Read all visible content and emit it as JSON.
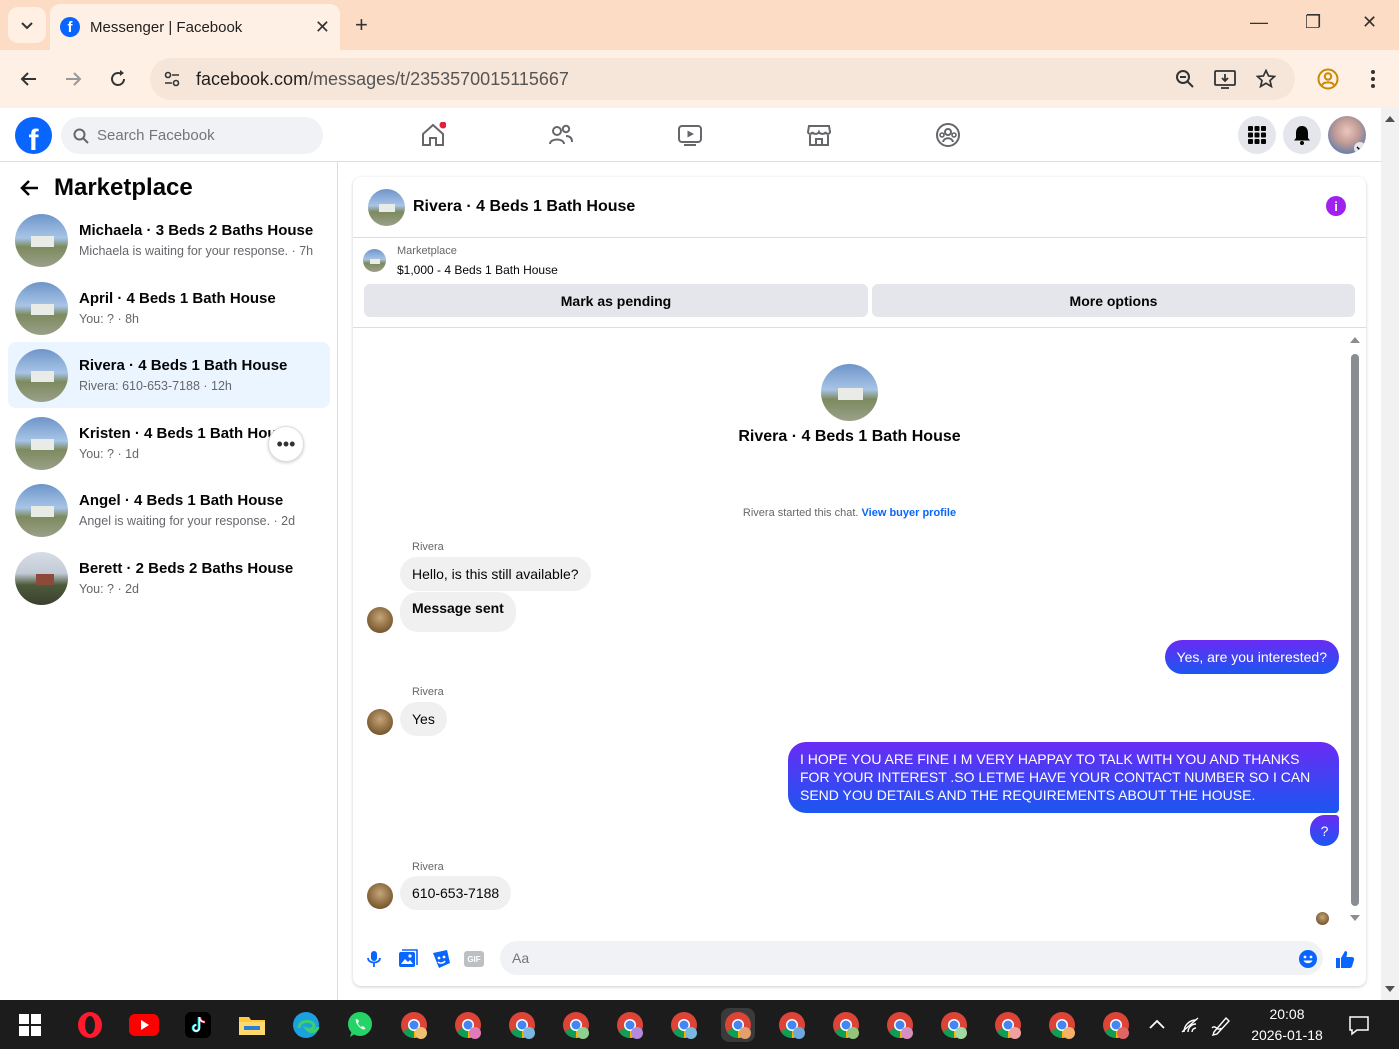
{
  "browser": {
    "tab_title": "Messenger | Facebook",
    "url_host": "facebook.com",
    "url_path": "/messages/t/2353570015115667"
  },
  "header": {
    "search_placeholder": "Search Facebook"
  },
  "sidebar": {
    "title": "Marketplace",
    "conversations": [
      {
        "name": "Michaela · 3 Beds 2 Baths House",
        "sub": "Michaela is waiting for your response. · 7h"
      },
      {
        "name": "April · 4 Beds 1 Bath House",
        "sub": "You: ? · 8h"
      },
      {
        "name": "Rivera · 4 Beds 1 Bath House",
        "sub": "Rivera: 610-653-7188 · 12h"
      },
      {
        "name": "Kristen · 4 Beds 1 Bath House",
        "sub": "You: ? · 1d"
      },
      {
        "name": "Angel · 4 Beds 1 Bath House",
        "sub": "Angel is waiting for your response. · 2d"
      },
      {
        "name": "Berett · 2 Beds 2 Baths House",
        "sub": "You: ? · 2d"
      }
    ]
  },
  "chat": {
    "title": "Rivera · 4 Beds 1 Bath House",
    "marketplace_label": "Marketplace",
    "listing": "$1,000 - 4 Beds 1 Bath House",
    "mark_pending": "Mark as pending",
    "more_options": "More options",
    "center_title": "Rivera · 4 Beds 1 Bath House",
    "started_text": "Rivera started this chat.",
    "buyer_link": "View buyer profile",
    "messages": [
      {
        "sender": "Rivera",
        "text": "Hello, is this still available?"
      },
      {
        "text": "Message sent"
      },
      {
        "text": "Yes, are you interested?"
      },
      {
        "sender": "Rivera",
        "text": "Yes"
      },
      {
        "text": "I HOPE YOU ARE FINE I M VERY HAPPAY TO TALK WITH YOU AND THANKS FOR YOUR INTEREST .SO LETME HAVE YOUR CONTACT NUMBER SO I CAN SEND YOU DETAILS AND THE REQUIREMENTS ABOUT THE HOUSE."
      },
      {
        "text": "?"
      },
      {
        "sender": "Rivera",
        "text": "610-653-7188"
      }
    ],
    "composer_placeholder": "Aa",
    "gif_label": "GIF"
  },
  "taskbar": {
    "time": "20:08",
    "date": "2026-01-18"
  },
  "colors": {
    "accent": "#0866ff",
    "outgoing_bubble": "#4a3ff0",
    "info": "#a020f0",
    "tabstrip": "#fcdcc4"
  }
}
